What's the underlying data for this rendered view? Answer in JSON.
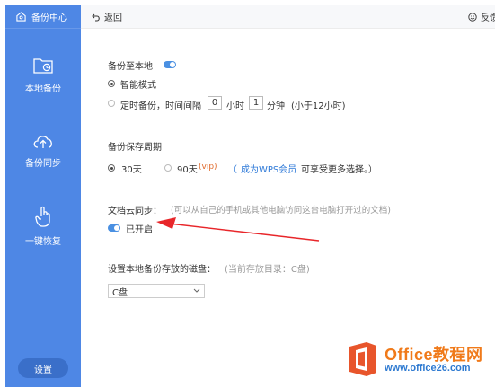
{
  "sidebar": {
    "header": "备份中心",
    "items": [
      {
        "label": "本地备份",
        "icon": "folder-clock-icon"
      },
      {
        "label": "备份同步",
        "icon": "cloud-upload-icon"
      },
      {
        "label": "一键恢复",
        "icon": "hand-pointer-icon"
      }
    ],
    "settings_label": "设置"
  },
  "topbar": {
    "back_label": "返回",
    "feedback_label": "反馈"
  },
  "local_backup": {
    "title": "备份至本地",
    "enabled": true,
    "smart_mode_label": "智能模式",
    "timed_label": "定时备份，时间间隔",
    "hours_value": "0",
    "hours_unit": "小时",
    "minutes_value": "1",
    "minutes_unit": "分钟",
    "limit_note": "(小于12小时)"
  },
  "retention": {
    "title": "备份保存周期",
    "opt_30": "30天",
    "opt_90": "90天",
    "opt_90_vip": "(vip)",
    "paren_open": "（",
    "wps_member_link": "成为WPS会员",
    "more_choices": "可享受更多选择。）"
  },
  "cloud_sync": {
    "title": "文档云同步：",
    "hint": "(可以从自己的手机或其他电脑访问这台电脑打开过的文档)",
    "status": "已开启",
    "enabled": true
  },
  "disk": {
    "title": "设置本地备份存放的磁盘：",
    "current_dir": "(当前存放目录：C盘)",
    "selected": "C盘"
  },
  "watermark": {
    "title": "Office教程网",
    "url": "www.office26.com"
  },
  "colors": {
    "sidebar_bg": "#4e87e5",
    "accent": "#4a90e2",
    "arrow": "#e8262a"
  }
}
